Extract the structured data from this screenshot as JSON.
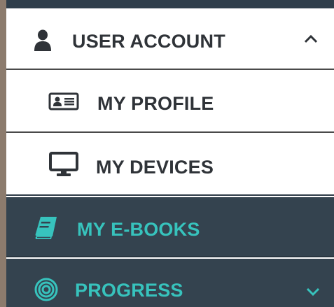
{
  "menu": {
    "user_account": {
      "label": "USER ACCOUNT",
      "icon": "user-icon",
      "chevron": "chevron-up-icon",
      "expanded": true
    },
    "items": [
      {
        "label": "MY PROFILE",
        "icon": "id-card-icon"
      },
      {
        "label": "MY DEVICES",
        "icon": "monitor-icon"
      }
    ],
    "ebooks": {
      "label": "MY E-BOOKS",
      "icon": "book-icon"
    },
    "progress": {
      "label": "PROGRESS",
      "icon": "target-icon",
      "chevron": "chevron-down-icon",
      "expanded": false
    }
  },
  "colors": {
    "dark_bg": "#34434f",
    "accent_teal": "#37c3bd",
    "text_dark": "#2f3338",
    "white_bg": "#ffffff"
  }
}
